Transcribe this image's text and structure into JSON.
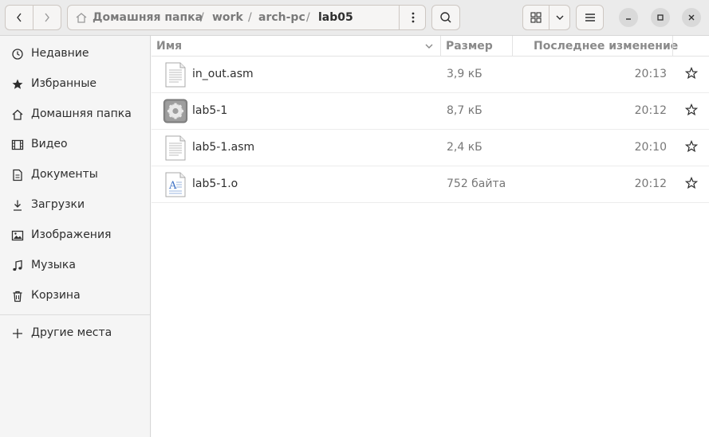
{
  "path": {
    "home": "Домашняя папка",
    "crumbs": [
      "work",
      "arch-pc",
      "lab05"
    ]
  },
  "sidebar": {
    "items": [
      {
        "label": "Недавние",
        "icon": "clock-icon"
      },
      {
        "label": "Избранные",
        "icon": "star-icon"
      },
      {
        "label": "Домашняя папка",
        "icon": "home-icon"
      },
      {
        "label": "Видео",
        "icon": "film-icon"
      },
      {
        "label": "Документы",
        "icon": "document-icon"
      },
      {
        "label": "Загрузки",
        "icon": "download-icon"
      },
      {
        "label": "Изображения",
        "icon": "image-icon"
      },
      {
        "label": "Музыка",
        "icon": "music-icon"
      },
      {
        "label": "Корзина",
        "icon": "trash-icon"
      }
    ],
    "other": {
      "label": "Другие места",
      "icon": "plus-icon"
    }
  },
  "columns": {
    "name": "Имя",
    "size": "Размер",
    "modified": "Последнее изменение"
  },
  "files": [
    {
      "name": "in_out.asm",
      "size": "3,9 кБ",
      "modified": "20:13",
      "icon": "text-file-icon"
    },
    {
      "name": "lab5-1",
      "size": "8,7 кБ",
      "modified": "20:12",
      "icon": "executable-icon"
    },
    {
      "name": "lab5-1.asm",
      "size": "2,4 кБ",
      "modified": "20:10",
      "icon": "text-file-icon"
    },
    {
      "name": "lab5-1.o",
      "size": "752 байта",
      "modified": "20:12",
      "icon": "object-file-icon"
    }
  ]
}
